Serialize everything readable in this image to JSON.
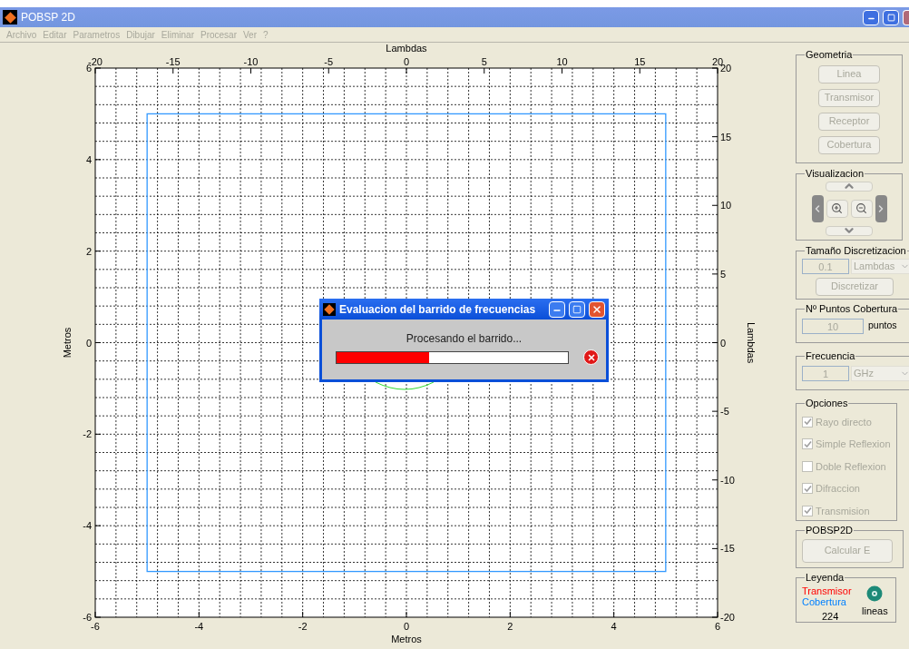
{
  "window": {
    "title": "POBSP 2D"
  },
  "menu": [
    {
      "label": "Archivo",
      "disabled": true
    },
    {
      "label": "Editar",
      "disabled": true
    },
    {
      "label": "Parametros",
      "disabled": true
    },
    {
      "label": "Dibujar",
      "disabled": true
    },
    {
      "label": "Eliminar",
      "disabled": true
    },
    {
      "label": "Procesar",
      "disabled": true
    },
    {
      "label": "Ver",
      "disabled": true
    },
    {
      "label": "?",
      "disabled": true
    }
  ],
  "plot": {
    "top_axis": {
      "label": "Lambdas",
      "ticks": [
        "-20",
        "-15",
        "-10",
        "-5",
        "0",
        "5",
        "10",
        "15",
        "20"
      ]
    },
    "right_axis": {
      "label": "Lambdas",
      "ticks": [
        "20",
        "15",
        "10",
        "5",
        "0",
        "-5",
        "-10",
        "-15",
        "-20"
      ]
    },
    "bottom_axis": {
      "label": "Metros",
      "ticks": [
        "-6",
        "-4",
        "-2",
        "0",
        "2",
        "4",
        "6"
      ]
    },
    "left_axis": {
      "label": "Metros",
      "ticks": [
        "6",
        "4",
        "2",
        "0",
        "-2",
        "-4",
        "-6"
      ]
    }
  },
  "dialog": {
    "title": "Evaluacion del barrido de frecuencias",
    "message": "Procesando el barrido...",
    "level": 0.4
  },
  "geometria": {
    "title": "Geometria",
    "buttons": [
      {
        "label": "Linea",
        "disabled": true
      },
      {
        "label": "Transmisor",
        "disabled": true
      },
      {
        "label": "Receptor",
        "disabled": true
      },
      {
        "label": "Cobertura",
        "disabled": true
      }
    ]
  },
  "visualizacion": {
    "title": "Visualizacion"
  },
  "discretizacion": {
    "title": "Tamaño Discretizacion",
    "value": "0.1",
    "unit": "Lambdas",
    "button": {
      "label": "Discretizar",
      "disabled": true
    }
  },
  "puntos": {
    "title": "Nº Puntos Cobertura",
    "value": "10",
    "unit": "puntos"
  },
  "frecuencia": {
    "title": "Frecuencia",
    "value": "1",
    "unit": "GHz"
  },
  "opciones": {
    "title": "Opciones",
    "items": [
      {
        "label": "Rayo directo",
        "checked": true,
        "disabled": true
      },
      {
        "label": "Simple Reflexion",
        "checked": true,
        "disabled": true
      },
      {
        "label": "Doble Reflexion",
        "checked": false,
        "disabled": true
      },
      {
        "label": "Difraccion",
        "checked": true,
        "disabled": true
      },
      {
        "label": "Transmision",
        "checked": true,
        "disabled": true
      }
    ]
  },
  "pobsp": {
    "title": "POBSP2D",
    "button": {
      "label": "Calcular E",
      "disabled": true
    }
  },
  "leyenda": {
    "title": "Leyenda",
    "items": [
      {
        "label": "Transmisor",
        "color": "#ff0000"
      },
      {
        "label": "Cobertura",
        "color": "#0080ff"
      }
    ],
    "count": "224",
    "unit": "lineas"
  }
}
